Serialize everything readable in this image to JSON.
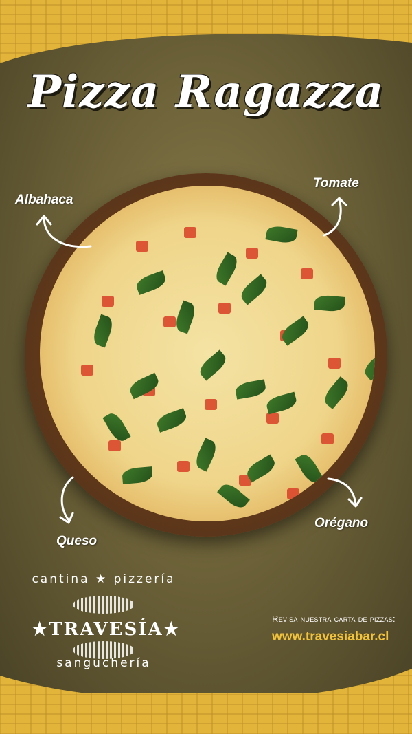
{
  "title": "Pizza Ragazza",
  "labels": {
    "albahaca": "Albahaca",
    "tomate": "Tomate",
    "queso": "Queso",
    "oregano": "Orégano"
  },
  "brand": {
    "top_text": "cantina ★ pizzería",
    "name": "★TRAVESÍA★",
    "bottom_text": "sanguchería",
    "logo_image_text": [
      "sanguchería"
    ]
  },
  "cta": {
    "line": "Revisa nuestra carta de pizzas:",
    "url": "www.travesiabar.cl"
  },
  "colors": {
    "accent_yellow": "#f2c33a",
    "band": "#e3b43a",
    "card": "#6e6339"
  },
  "icons": [
    "pizza-image",
    "arrow-icon",
    "city-illustration"
  ]
}
